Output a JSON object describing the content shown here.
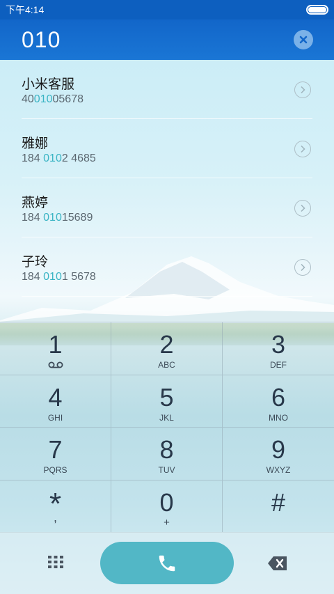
{
  "status_bar": {
    "time": "下午4:14"
  },
  "dialer": {
    "number": "010"
  },
  "results": [
    {
      "name": "小米客服",
      "phone_pre": "40",
      "phone_match": "010",
      "phone_post": "05678"
    },
    {
      "name": "雅娜",
      "phone_pre": "184 ",
      "phone_match": "010",
      "phone_post": "2 4685"
    },
    {
      "name": "燕婷",
      "phone_pre": "184 ",
      "phone_match": "010",
      "phone_post": "15689"
    },
    {
      "name": "子玲",
      "phone_pre": "184 ",
      "phone_match": "010",
      "phone_post": "1 5678"
    }
  ],
  "keypad": [
    {
      "digit": "1",
      "letters": "",
      "icon": "voicemail-icon"
    },
    {
      "digit": "2",
      "letters": "ABC"
    },
    {
      "digit": "3",
      "letters": "DEF"
    },
    {
      "digit": "4",
      "letters": "GHI"
    },
    {
      "digit": "5",
      "letters": "JKL"
    },
    {
      "digit": "6",
      "letters": "MNO"
    },
    {
      "digit": "7",
      "letters": "PQRS"
    },
    {
      "digit": "8",
      "letters": "TUV"
    },
    {
      "digit": "9",
      "letters": "WXYZ"
    },
    {
      "digit": "*",
      "letters": ","
    },
    {
      "digit": "0",
      "letters": "+"
    },
    {
      "digit": "#",
      "letters": ""
    }
  ],
  "colors": {
    "header": "#1266c9",
    "highlight": "#3ab4c4",
    "call_button": "#52b7c6"
  },
  "icons": {
    "clear": "close-icon",
    "detail": "chevron-right-icon",
    "dialpad_toggle": "dialpad-grid-icon",
    "call": "phone-icon",
    "backspace": "backspace-icon"
  }
}
